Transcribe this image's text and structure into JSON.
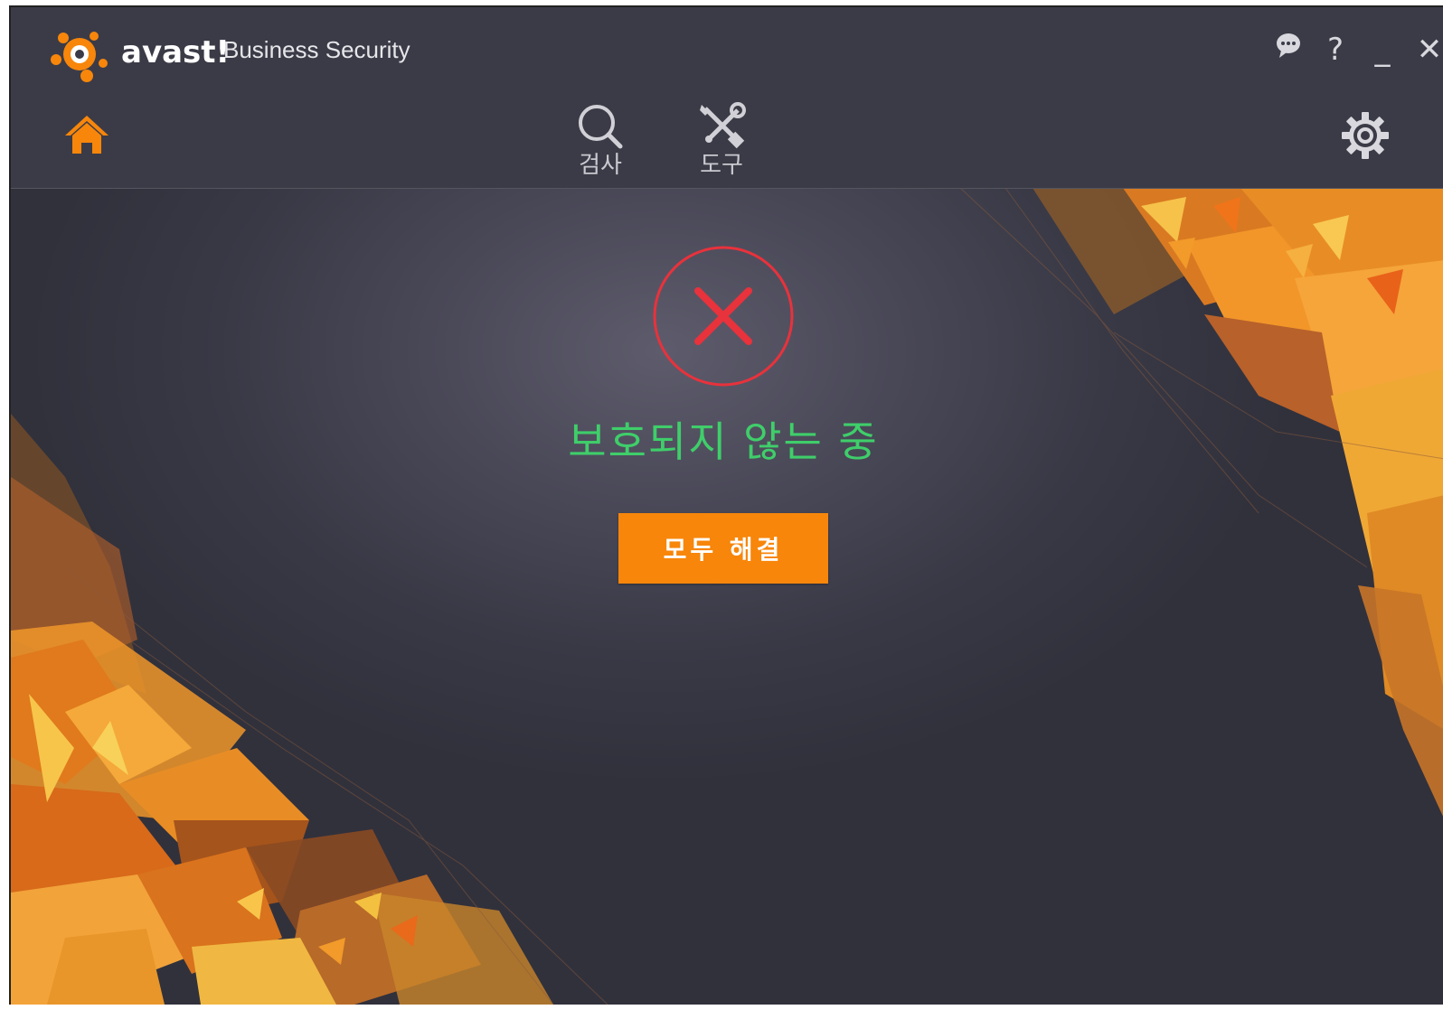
{
  "app": {
    "logo_text": "avast!",
    "product_name": "Business Security"
  },
  "window_controls": {
    "feedback_icon": "speech-bubble-icon",
    "help_label": "?",
    "minimize_label": "_",
    "close_label": "✕"
  },
  "nav": {
    "home_icon": "home-icon",
    "scan": {
      "label": "검사",
      "icon": "magnifier-icon"
    },
    "tools": {
      "label": "도구",
      "icon": "wrench-screwdriver-icon"
    },
    "settings_icon": "gear-icon"
  },
  "status": {
    "icon": "error-x-icon",
    "text": "보호되지 않는 중",
    "resolve_button_label": "모두 해결"
  },
  "colors": {
    "accent_orange": "#f7860b",
    "status_red": "#e8323c",
    "status_text_green": "#3fce6a",
    "header_bg": "#3b3b47",
    "body_bg": "#393946"
  }
}
